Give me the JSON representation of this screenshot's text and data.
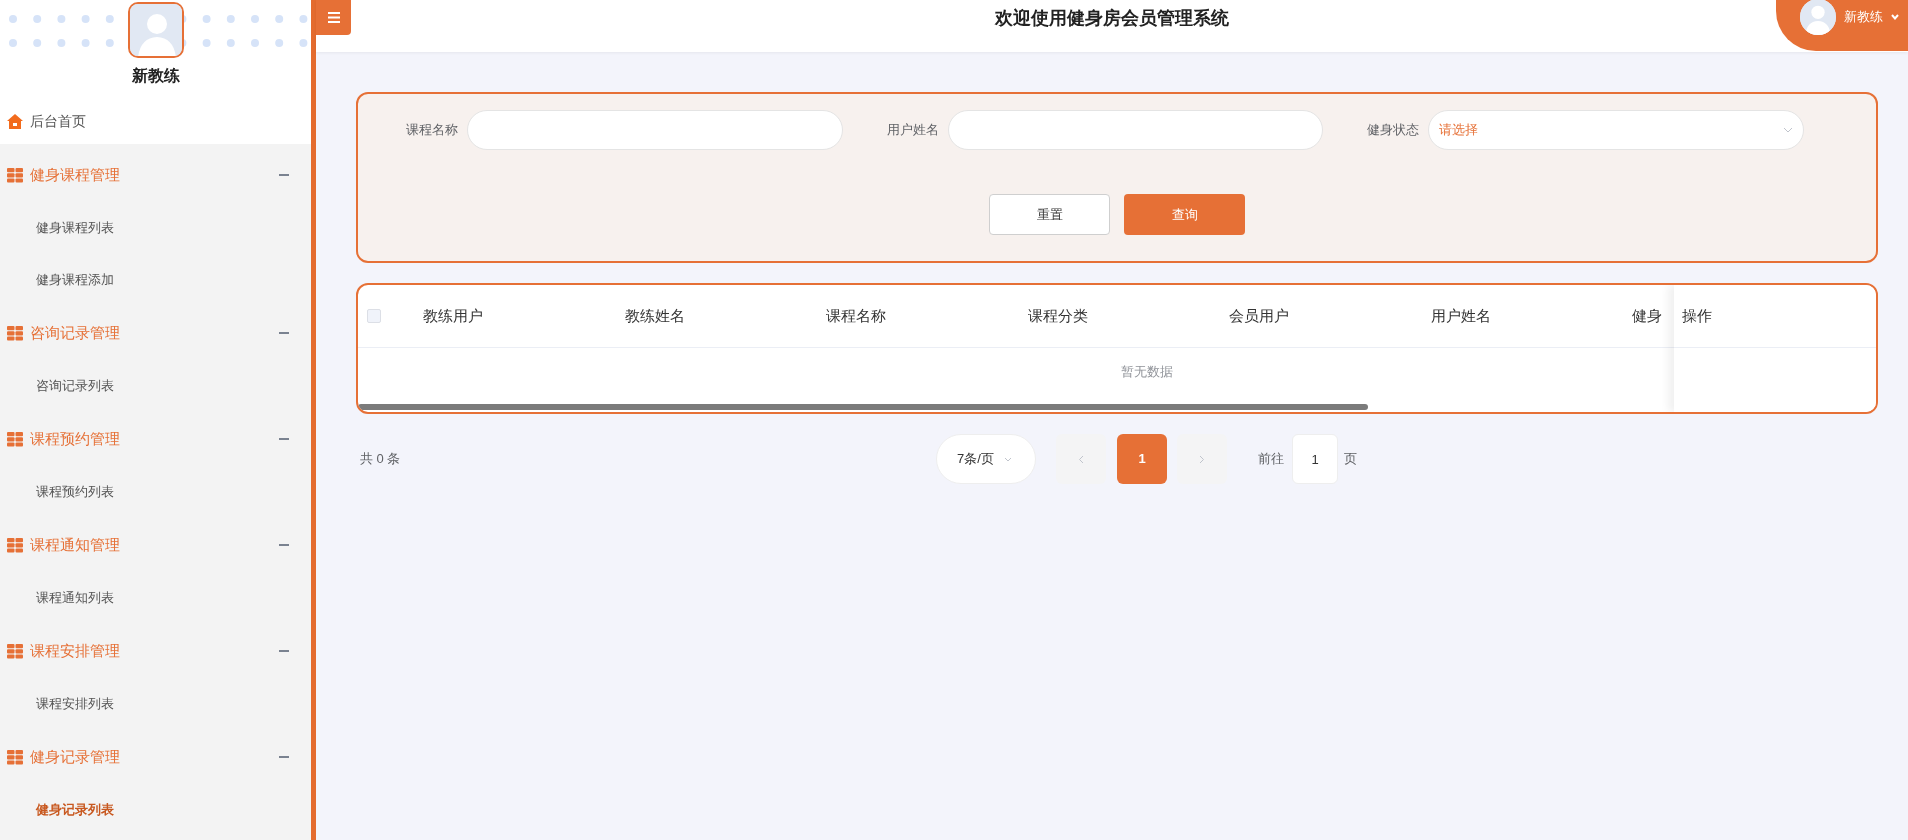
{
  "header": {
    "title": "欢迎使用健身房会员管理系统",
    "user_name": "新教练"
  },
  "sidebar": {
    "user_name": "新教练",
    "home": {
      "label": "后台首页"
    },
    "groups": [
      {
        "label": "健身课程管理",
        "expanded": true,
        "items": [
          {
            "label": "健身课程列表",
            "selected": false
          },
          {
            "label": "健身课程添加",
            "selected": false
          }
        ]
      },
      {
        "label": "咨询记录管理",
        "expanded": true,
        "items": [
          {
            "label": "咨询记录列表",
            "selected": false
          }
        ]
      },
      {
        "label": "课程预约管理",
        "expanded": true,
        "items": [
          {
            "label": "课程预约列表",
            "selected": false
          }
        ]
      },
      {
        "label": "课程通知管理",
        "expanded": true,
        "items": [
          {
            "label": "课程通知列表",
            "selected": false
          }
        ]
      },
      {
        "label": "课程安排管理",
        "expanded": true,
        "items": [
          {
            "label": "课程安排列表",
            "selected": false
          }
        ]
      },
      {
        "label": "健身记录管理",
        "expanded": true,
        "items": [
          {
            "label": "健身记录列表",
            "selected": true
          }
        ]
      }
    ]
  },
  "search": {
    "fields": [
      {
        "label": "课程名称",
        "kind": "input"
      },
      {
        "label": "用户姓名",
        "kind": "input"
      },
      {
        "label": "健身状态",
        "kind": "select",
        "placeholder": "请选择"
      }
    ],
    "buttons": [
      {
        "label": "重置",
        "kind": "secondary"
      },
      {
        "label": "查询",
        "kind": "primary"
      }
    ]
  },
  "table": {
    "select_all_checked": false,
    "columns": [
      "教练用户",
      "教练姓名",
      "课程名称",
      "课程分类",
      "会员用户",
      "用户姓名",
      "健身"
    ],
    "action_column": "操作",
    "empty_text": "暂无数据"
  },
  "pagination": {
    "total": "共 0 条",
    "page_size": "7条/页",
    "pages": [
      {
        "label": "1",
        "selected": true
      }
    ],
    "goto_label": "前往",
    "goto_value": "1",
    "page_suffix": "页"
  }
}
